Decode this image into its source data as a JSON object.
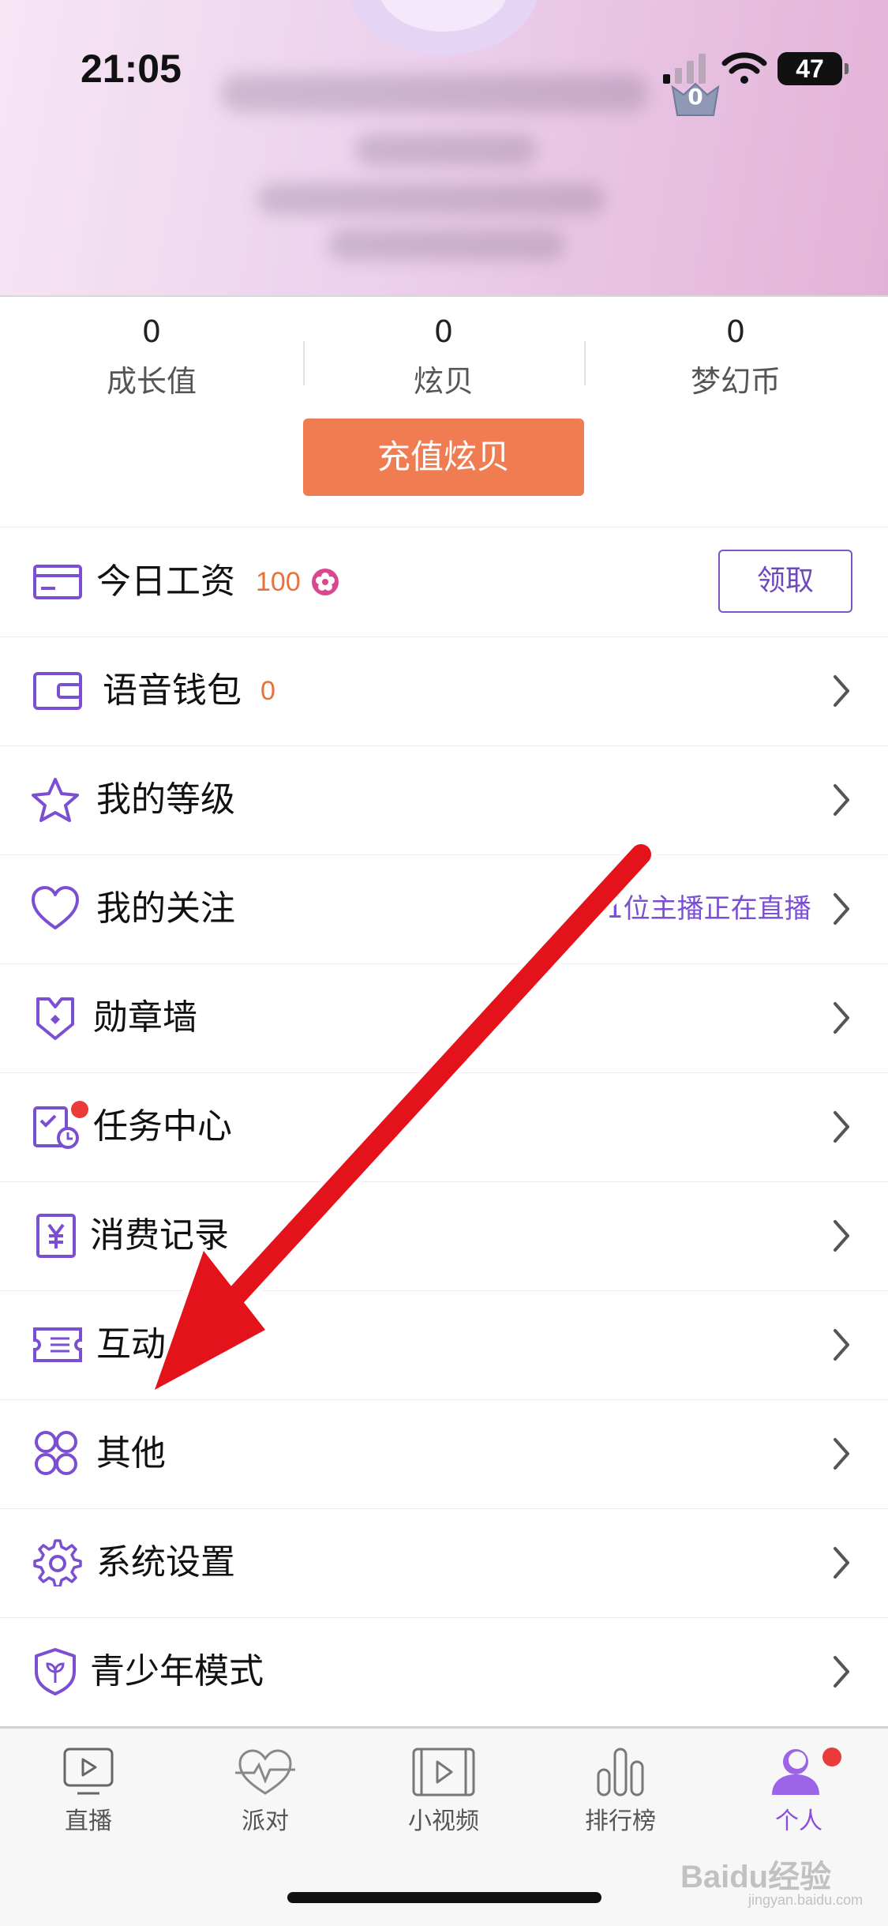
{
  "status_bar": {
    "time": "21:05",
    "battery": "47"
  },
  "header": {
    "level_badge": "0"
  },
  "stats": [
    {
      "value": "0",
      "label": "成长值"
    },
    {
      "value": "0",
      "label": "炫贝"
    },
    {
      "value": "0",
      "label": "梦幻币"
    }
  ],
  "recharge_label": "充值炫贝",
  "wage": {
    "label": "今日工资",
    "amount": "100",
    "claim_label": "领取"
  },
  "menu": [
    {
      "label": "语音钱包",
      "extra": "0"
    },
    {
      "label": "我的等级"
    },
    {
      "label": "我的关注",
      "extra": "1位主播正在直播"
    },
    {
      "label": "勋章墙"
    },
    {
      "label": "任务中心"
    },
    {
      "label": "消费记录"
    },
    {
      "label": "互动"
    },
    {
      "label": "其他"
    },
    {
      "label": "系统设置"
    },
    {
      "label": "青少年模式"
    }
  ],
  "tabs": [
    {
      "label": "直播"
    },
    {
      "label": "派对"
    },
    {
      "label": "小视频"
    },
    {
      "label": "排行榜"
    },
    {
      "label": "个人",
      "active": true
    }
  ],
  "watermark": {
    "text": "Baidu经验",
    "sub": "jingyan.baidu.com"
  },
  "colors": {
    "accent_purple": "#7b4fd1",
    "orange": "#f07d52",
    "annotation_arrow": "#e4121b",
    "notification_dot": "#ea3a3a"
  }
}
